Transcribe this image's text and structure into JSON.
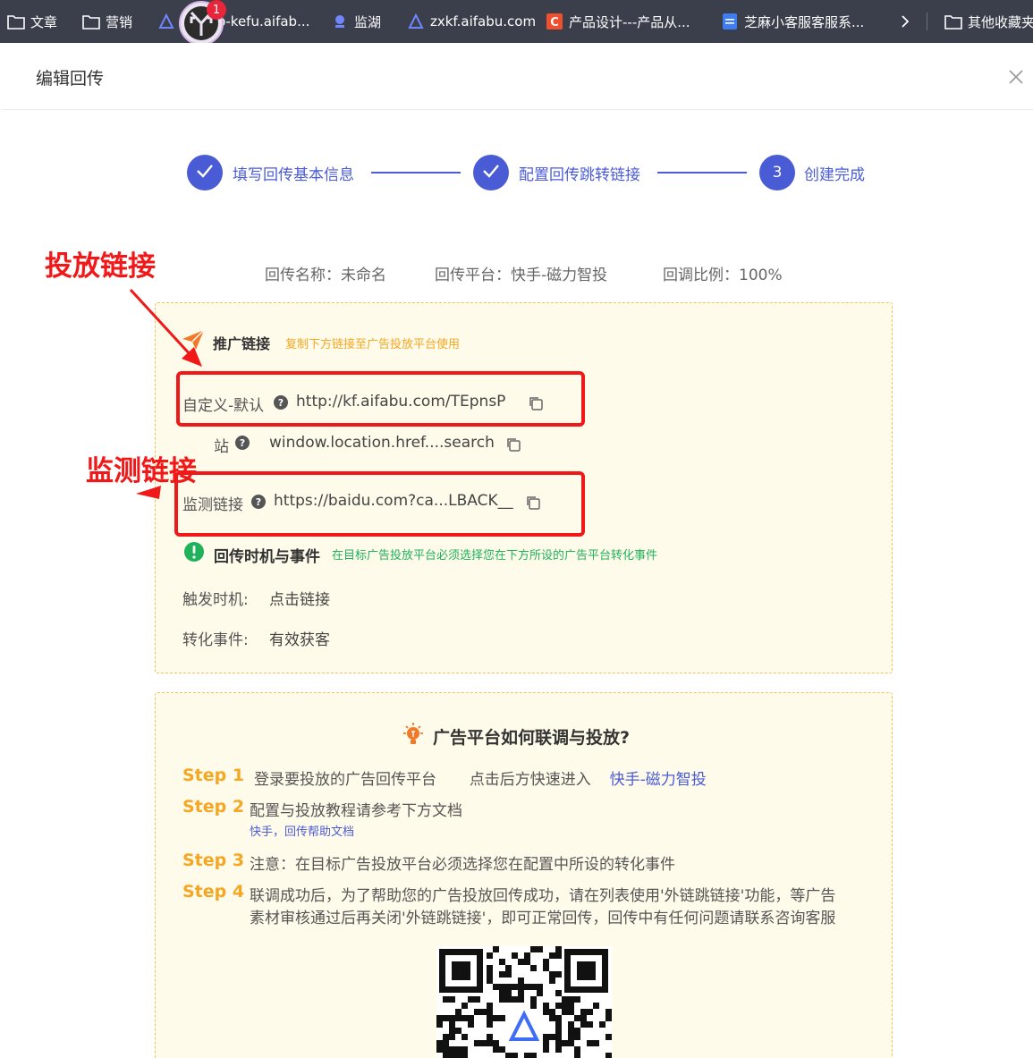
{
  "bookmarks": [
    {
      "label": "文章",
      "icon": "folder-icon"
    },
    {
      "label": "营销",
      "icon": "folder-icon"
    },
    {
      "label": "sh...eb-kefu.aifab...",
      "icon": "aifabu-logo-icon"
    },
    {
      "label": "监湖",
      "icon": "lake-icon"
    },
    {
      "label": "zxkf.aifabu.com",
      "icon": "aifabu-logo-icon"
    },
    {
      "label": "产品设计---产品从...",
      "icon": "c-logo-icon"
    },
    {
      "label": "芝麻小客服客服系...",
      "icon": "doc-icon"
    },
    {
      "label": "其他收藏夹",
      "icon": "folder-icon"
    }
  ],
  "overlay_badge": "1",
  "dialog": {
    "title": "编辑回传",
    "steps": [
      {
        "label": "填写回传基本信息",
        "state": "done"
      },
      {
        "label": "配置回传跳转链接",
        "state": "done"
      },
      {
        "label": "创建完成",
        "state": "current",
        "number": "3"
      }
    ],
    "meta": {
      "name": "回传名称：未命名",
      "platform": "回传平台：快手-磁力智投",
      "ratio": "回调比例：100%"
    },
    "promo": {
      "title": "推广链接",
      "hint": "复制下方链接至广告投放平台使用",
      "rows": [
        {
          "label": "自定义-默认",
          "value": "http://kf.aifabu.com/TEpnsP"
        },
        {
          "label": "站",
          "value": "window.location.href....search"
        },
        {
          "label": "监测链接",
          "value": "https://baidu.com?ca...LBACK__"
        }
      ]
    },
    "events": {
      "title": "回传时机与事件",
      "hint": "在目标广告投放平台必须选择您在下方所设的广告平台转化事件",
      "trigger_label": "触发时机:",
      "trigger_value": "点击链接",
      "convert_label": "转化事件:",
      "convert_value": "有效获客"
    },
    "how": {
      "title": "广告平台如何联调与投放?",
      "steps": [
        {
          "tag": "Step 1",
          "text": "登录要投放的广告回传平台",
          "text2": "点击后方快速进入",
          "link": "快手-磁力智投"
        },
        {
          "tag": "Step 2",
          "text": "配置与投放教程请参考下方文档",
          "sublink": "快手，回传帮助文档"
        },
        {
          "tag": "Step 3",
          "text": "注意：在目标广告投放平台必须选择您在配置中所设的转化事件"
        },
        {
          "tag": "Step 4",
          "text": "联调成功后，为了帮助您的广告投放回传成功，请在列表使用'外链跳链接'功能，等广告",
          "text2": "素材审核通过后再关闭'外链跳链接'，即可正常回传，回传中有任何问题请联系咨询客服"
        }
      ]
    }
  },
  "annotations": {
    "promo_link": "投放链接",
    "monitor_link": "监测链接"
  },
  "colors": {
    "primary": "#4a5bd6",
    "accent_orange": "#f5a623",
    "annotation_red": "#f01818",
    "success_green": "#1fb25a"
  }
}
